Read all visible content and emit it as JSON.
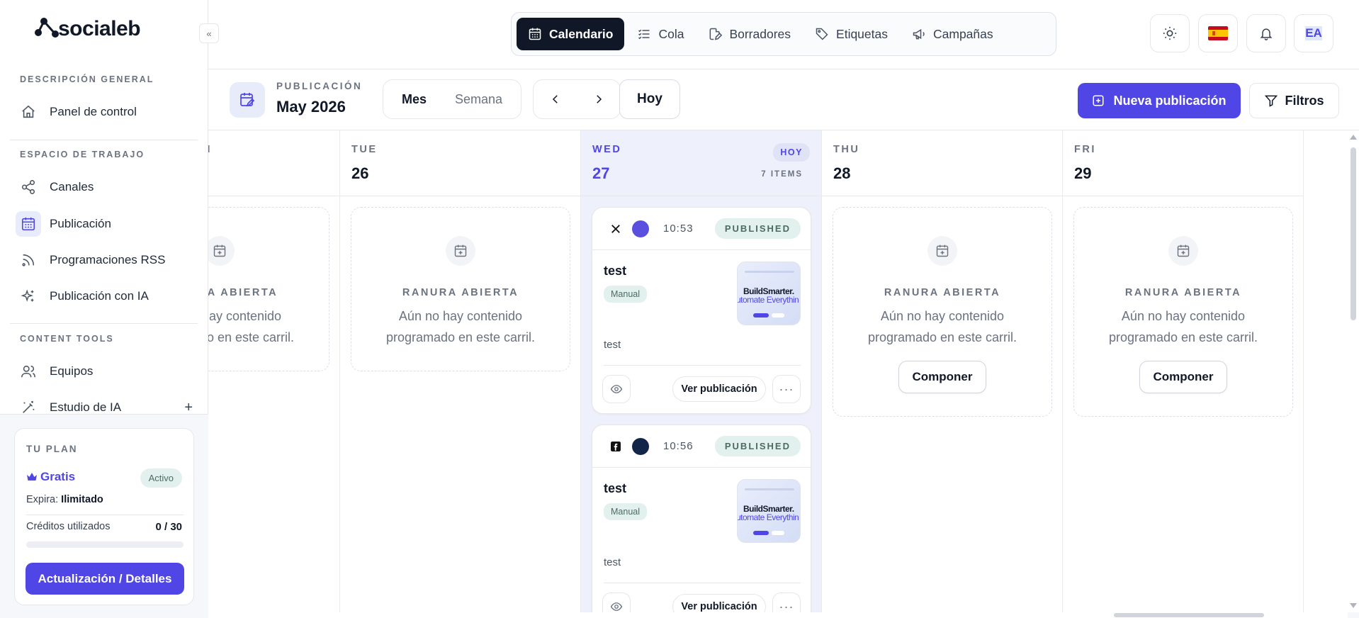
{
  "brand": {
    "name": "socialeb"
  },
  "sidebar": {
    "collapse_label": "«",
    "sections": [
      {
        "label": "DESCRIPCIÓN GENERAL"
      },
      {
        "label": "ESPACIO DE TRABAJO"
      },
      {
        "label": "CONTENT TOOLS"
      }
    ],
    "items": [
      {
        "label": "Panel de control",
        "icon": "home-icon"
      },
      {
        "label": "Canales",
        "icon": "share-icon"
      },
      {
        "label": "Publicación",
        "icon": "calendar-icon",
        "active": true
      },
      {
        "label": "Programaciones RSS",
        "icon": "rss-icon"
      },
      {
        "label": "Publicación con IA",
        "icon": "sparkles-icon"
      },
      {
        "label": "Equipos",
        "icon": "users-icon"
      },
      {
        "label": "Estudio de IA",
        "icon": "magic-wand-icon",
        "plus": "+"
      }
    ],
    "plan": {
      "title": "TU PLAN",
      "name": "Gratis",
      "status": "Activo",
      "expires_label": "Expira:",
      "expires_value": "Ilimitado",
      "credits_label": "Créditos utilizados",
      "credits_value": "0 / 30",
      "credits_fraction": 0,
      "upgrade_label": "Actualización / Detalles"
    }
  },
  "header": {
    "tabs": [
      {
        "label": "Calendario",
        "icon": "calendar-icon",
        "active": true
      },
      {
        "label": "Cola",
        "icon": "list-icon"
      },
      {
        "label": "Borradores",
        "icon": "draft-icon"
      },
      {
        "label": "Etiquetas",
        "icon": "tag-icon"
      },
      {
        "label": "Campañas",
        "icon": "megaphone-icon"
      }
    ],
    "avatar_initials": "EA"
  },
  "toolbar": {
    "section_label": "PUBLICACIÓN",
    "period": "May 2026",
    "views": [
      "Mes",
      "Semana"
    ],
    "today_label": "Hoy",
    "new_post_label": "Nueva publicación",
    "filters_label": "Filtros"
  },
  "calendar": {
    "days": [
      {
        "dow": "N",
        "num": ""
      },
      {
        "dow": "TUE",
        "num": "26"
      },
      {
        "dow": "WED",
        "num": "27",
        "today_badge": "HOY",
        "items_count": "7 ITEMS"
      },
      {
        "dow": "THU",
        "num": "28"
      },
      {
        "dow": "FRI",
        "num": "29"
      }
    ],
    "open_slot": {
      "title": "RANURA ABIERTA",
      "text": "Aún no hay contenido programado en este carril.",
      "compose_label": "Componer"
    },
    "posts": [
      {
        "platform": "x-icon",
        "time": "10:53",
        "status": "PUBLISHED",
        "title": "test",
        "tag": "Manual",
        "thumb_line1": "BuildSmarter.",
        "thumb_line2": "utomate Everythin",
        "description": "test",
        "view_label": "Ver publicación",
        "more": "···"
      },
      {
        "platform": "facebook-icon",
        "time": "10:56",
        "status": "PUBLISHED",
        "title": "test",
        "tag": "Manual",
        "thumb_line1": "BuildSmarter.",
        "thumb_line2": "utomate Everythin",
        "description": "test",
        "view_label": "Ver publicación",
        "more": "···"
      }
    ]
  },
  "colors": {
    "accent": "#4f46e5",
    "dark": "#101828",
    "success_bg": "#e3f1ee"
  }
}
